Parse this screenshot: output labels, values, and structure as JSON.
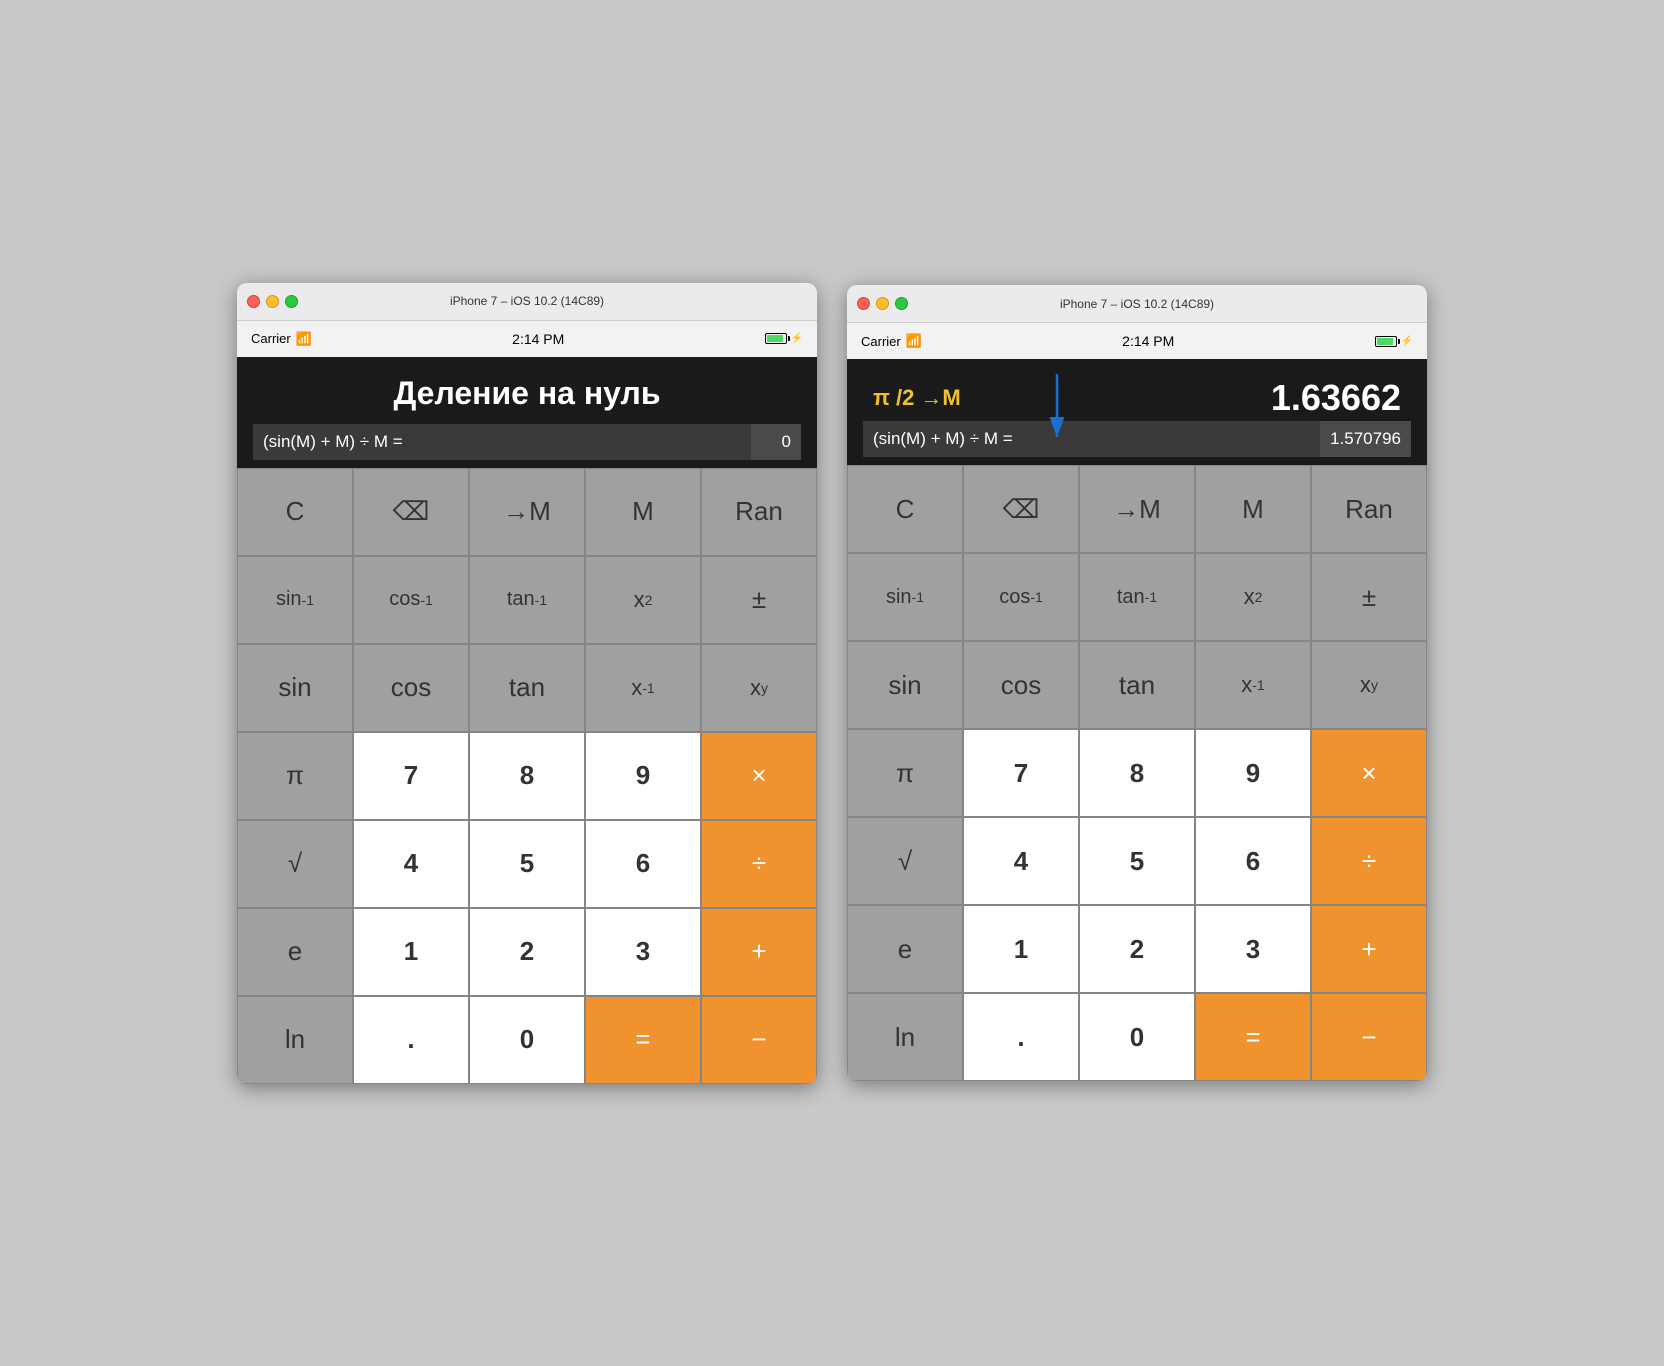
{
  "window_title": "iPhone 7 – iOS 10.2 (14C89)",
  "status": {
    "carrier": "Carrier",
    "wifi": "📶",
    "time": "2:14 PM"
  },
  "left_calc": {
    "display_title": "Деление на нуль",
    "expression": "(sin(M) + M) ÷ M =",
    "result": "0"
  },
  "right_calc": {
    "memory_label": "π /2 →M",
    "main_value": "1.63662",
    "expression": "(sin(M) + M) ÷ M =",
    "result": "1.570796"
  },
  "buttons": {
    "row1": [
      "C",
      "⌫",
      "→M",
      "M",
      "Ran"
    ],
    "row2_labels": [
      "sin⁻¹",
      "cos⁻¹",
      "tan⁻¹",
      "x²",
      "±"
    ],
    "row3_labels": [
      "sin",
      "cos",
      "tan",
      "x⁻¹",
      "xʸ"
    ],
    "row4": [
      "π",
      "7",
      "8",
      "9",
      "×"
    ],
    "row5": [
      "√",
      "4",
      "5",
      "6",
      "÷"
    ],
    "row6": [
      "e",
      "1",
      "2",
      "3",
      "+"
    ],
    "row7": [
      "ln",
      ".",
      "0",
      "=",
      "−"
    ]
  },
  "colors": {
    "orange": "#f0922e",
    "dark_gray": "#a0a0a0",
    "light_gray": "#d4d4d4",
    "white_key": "#ffffff",
    "display_bg": "#1a1a1a",
    "memory_yellow": "#f0c030",
    "arrow_blue": "#1a6fd4"
  }
}
